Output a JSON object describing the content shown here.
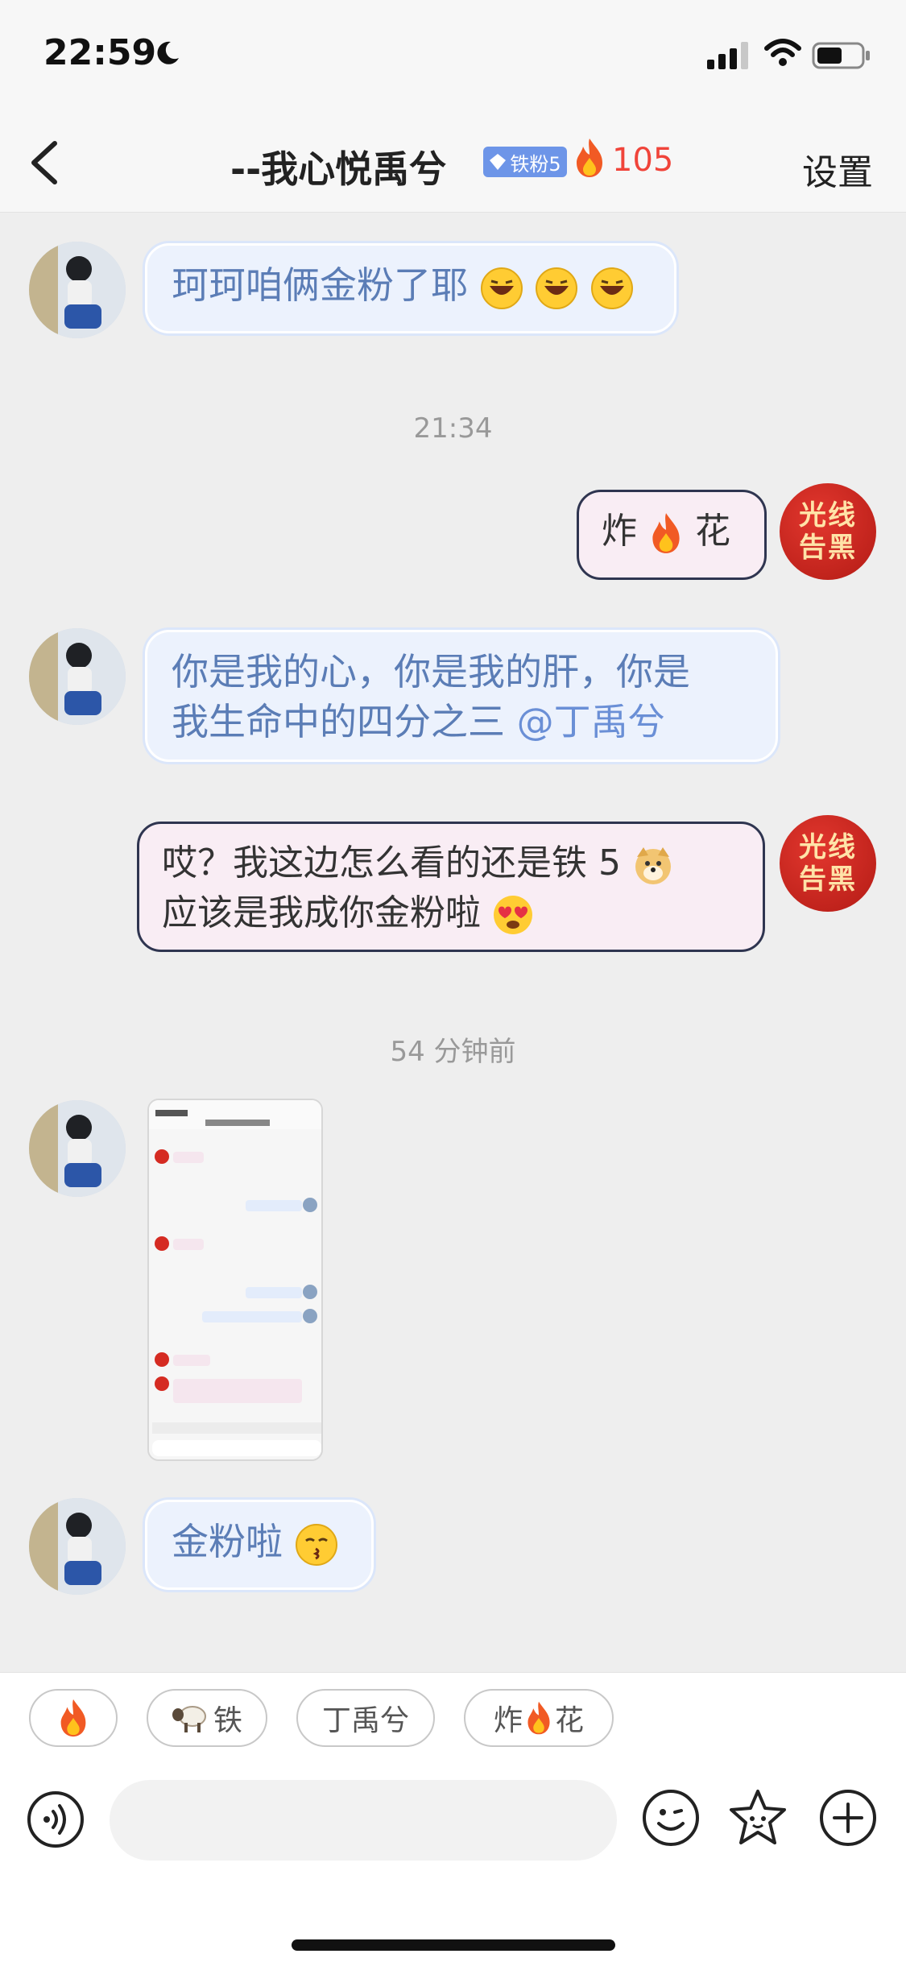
{
  "status": {
    "time": "22:59"
  },
  "header": {
    "back_icon": "chevron-left-icon",
    "title": "--我心悦禹兮",
    "fan_badge": "铁粉5",
    "streak": "105",
    "settings": "设置"
  },
  "messages": [
    {
      "sender": "other",
      "text": "珂珂咱俩金粉了耶",
      "emoji": [
        "laughing-emoji",
        "laughing-emoji",
        "laughing-emoji"
      ]
    },
    {
      "sender": "me",
      "text_a": "炸",
      "text_b": "花",
      "emoji": [
        "fire-emoji"
      ]
    },
    {
      "sender": "other",
      "line1": "你是我的心，你是我的肝，你是",
      "line2": "我生命中的四分之三 ",
      "mention": "@丁禹兮"
    },
    {
      "sender": "me",
      "line1": "哎？我这边怎么看的还是铁 5",
      "line2": "应该是我成你金粉啦",
      "emoji": [
        "doge-emoji",
        "heart-eyes-emoji"
      ]
    },
    {
      "sender": "other",
      "type": "image",
      "image_desc": "chat-screenshot"
    },
    {
      "sender": "other",
      "text": "金粉啦",
      "emoji": [
        "kissing-emoji"
      ]
    }
  ],
  "timestamps": [
    "21:34",
    "54 分钟前"
  ],
  "avatar_me_text": [
    "光线",
    "告黑"
  ],
  "quick_replies": [
    {
      "label": "",
      "icon": "fire-emoji"
    },
    {
      "label": "铁",
      "icon": "sheep-emoji"
    },
    {
      "label": "丁禹兮"
    },
    {
      "label_a": "炸",
      "label_b": "花",
      "icon": "fire-emoji"
    }
  ],
  "input": {
    "placeholder": ""
  },
  "colors": {
    "accent_red": "#f0443a",
    "badge_blue": "#6d95e8",
    "bubble_blue_text": "#5b7db6"
  }
}
